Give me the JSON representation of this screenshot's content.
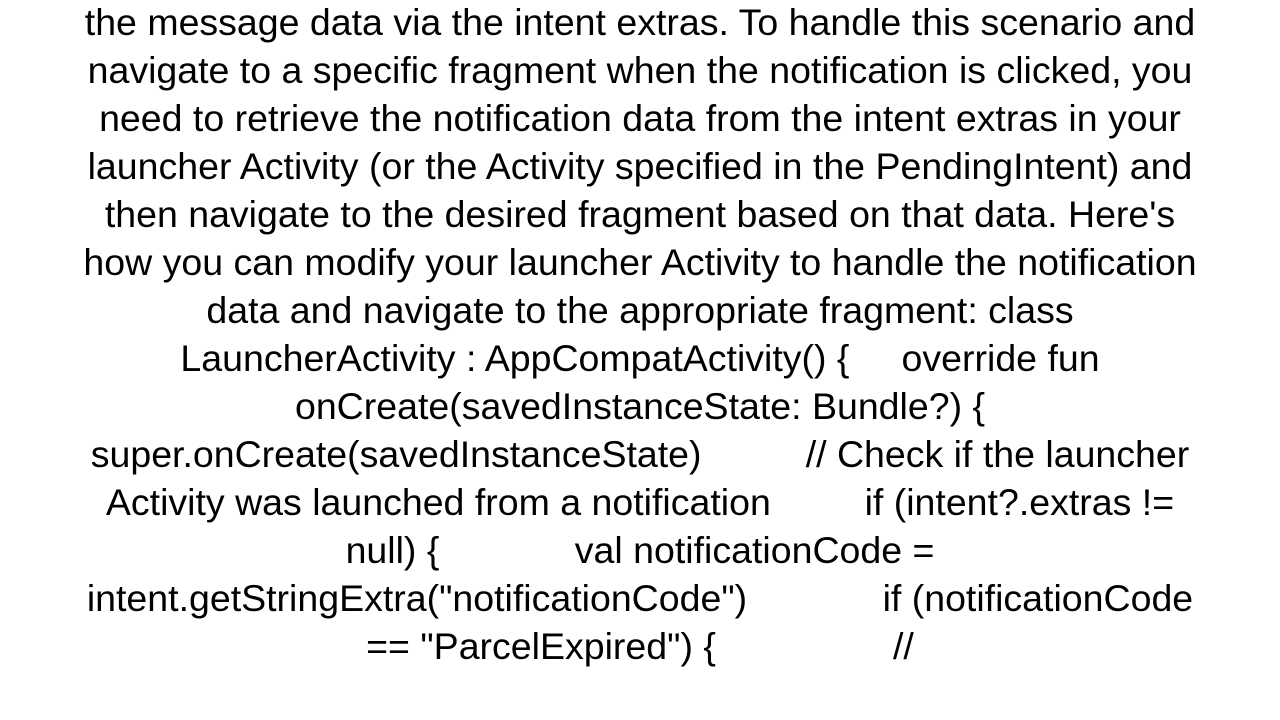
{
  "document": {
    "body_text": "the message data via the intent extras. To handle this scenario and navigate to a specific fragment when the notification is clicked, you need to retrieve the notification data from the intent extras in your launcher Activity (or the Activity specified in the PendingIntent) and then navigate to the desired fragment based on that data. Here's how you can modify your launcher Activity to handle the notification data and navigate to the appropriate fragment: class LauncherActivity : AppCompatActivity() {     override fun onCreate(savedInstanceState: Bundle?) {         super.onCreate(savedInstanceState)          // Check if the launcher Activity was launched from a notification         if (intent?.extras != null) {             val notificationCode = intent.getStringExtra(\"notificationCode\")             if (notificationCode == \"ParcelExpired\") {                 //"
  }
}
